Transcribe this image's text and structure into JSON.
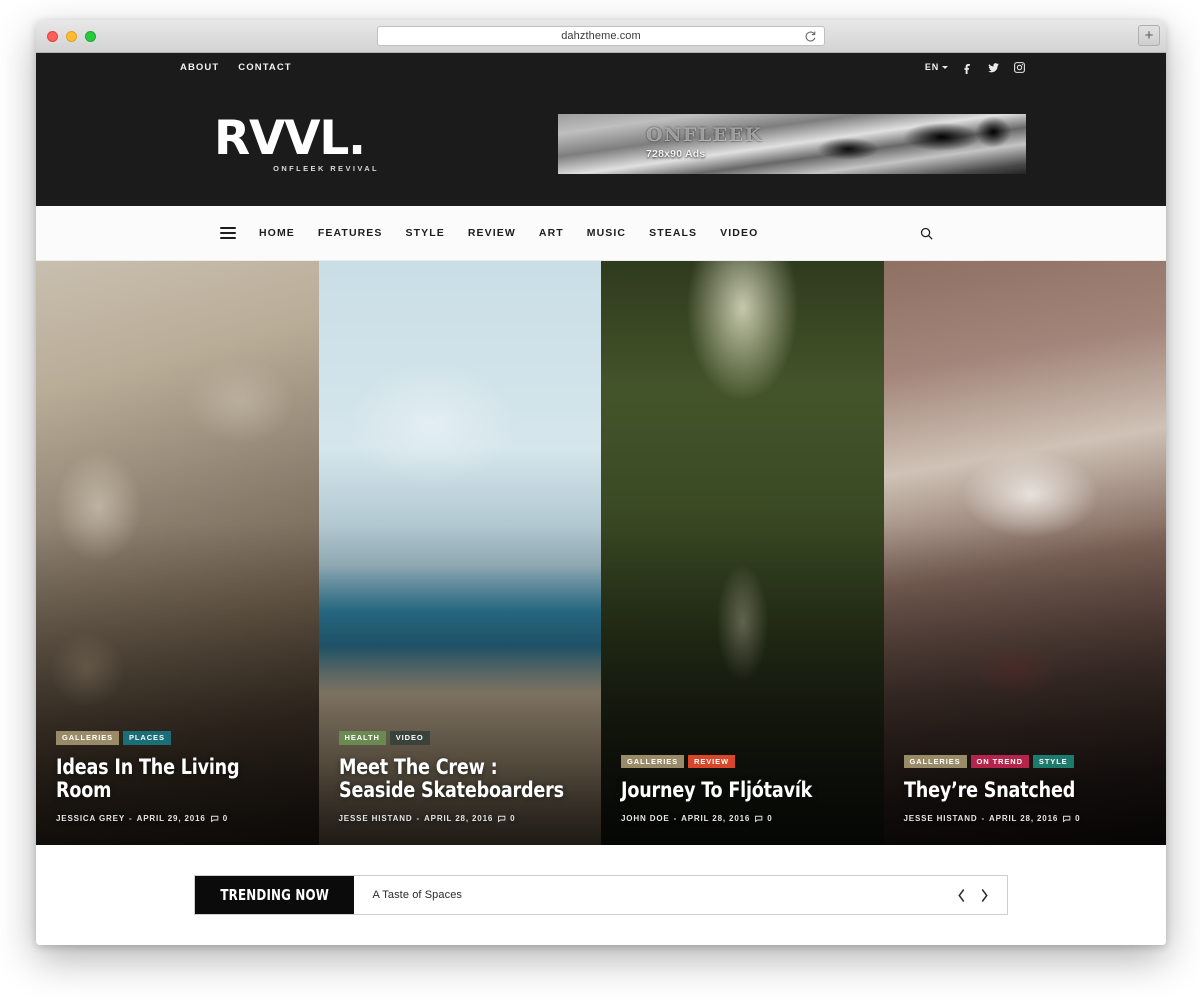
{
  "browser": {
    "url": "dahztheme.com",
    "reload_icon": "reload-icon",
    "newtab_label": "+",
    "traffic_lights": [
      "close",
      "minimize",
      "maximize"
    ]
  },
  "topbar": {
    "links": [
      {
        "label": "ABOUT"
      },
      {
        "label": "CONTACT"
      }
    ],
    "language": "EN",
    "social": [
      {
        "name": "facebook-icon"
      },
      {
        "name": "twitter-icon"
      },
      {
        "name": "instagram-icon"
      }
    ]
  },
  "masthead": {
    "logo": "RVVL.",
    "tagline": "ONFLEEK REVIVAL",
    "ad": {
      "title": "ONFLEEK",
      "subtitle": "728x90 Ads"
    }
  },
  "nav": {
    "menu_icon": "hamburger-icon",
    "items": [
      {
        "label": "HOME"
      },
      {
        "label": "FEATURES"
      },
      {
        "label": "STYLE"
      },
      {
        "label": "REVIEW"
      },
      {
        "label": "ART"
      },
      {
        "label": "MUSIC"
      },
      {
        "label": "STEALS"
      },
      {
        "label": "VIDEO"
      }
    ],
    "search_icon": "search-icon"
  },
  "colors": {
    "galleries": "#9a8b68",
    "places": "#1a6e78",
    "health": "#6b8a52",
    "video": "#3a423c",
    "review": "#d9472b",
    "on_trend": "#b5244a",
    "style": "#1f7a6e",
    "dark": "#1b1b1b"
  },
  "hero": {
    "cards": [
      {
        "title": "Ideas In The Living Room",
        "author": "JESSICA GREY",
        "date": "APRIL 29, 2016",
        "comments": "0",
        "tags": [
          {
            "label": "GALLERIES",
            "color": "#9a8b68"
          },
          {
            "label": "PLACES",
            "color": "#1a6e78"
          }
        ]
      },
      {
        "title": "Meet The Crew : Seaside Skateboarders",
        "author": "JESSE HISTAND",
        "date": "APRIL 28, 2016",
        "comments": "0",
        "tags": [
          {
            "label": "HEALTH",
            "color": "#6b8a52"
          },
          {
            "label": "VIDEO",
            "color": "#3a423c"
          }
        ]
      },
      {
        "title": "Journey To Fljótavík",
        "author": "JOHN DOE",
        "date": "APRIL 28, 2016",
        "comments": "0",
        "tags": [
          {
            "label": "GALLERIES",
            "color": "#9a8b68"
          },
          {
            "label": "REVIEW",
            "color": "#d9472b"
          }
        ]
      },
      {
        "title": "They’re Snatched",
        "author": "JESSE HISTAND",
        "date": "APRIL 28, 2016",
        "comments": "0",
        "tags": [
          {
            "label": "GALLERIES",
            "color": "#9a8b68"
          },
          {
            "label": "ON TREND",
            "color": "#b5244a"
          },
          {
            "label": "STYLE",
            "color": "#1f7a6e"
          }
        ]
      }
    ]
  },
  "trending": {
    "label": "TRENDING NOW",
    "item": "A Taste of Spaces",
    "prev_icon": "chevron-left-icon",
    "next_icon": "chevron-right-icon"
  }
}
